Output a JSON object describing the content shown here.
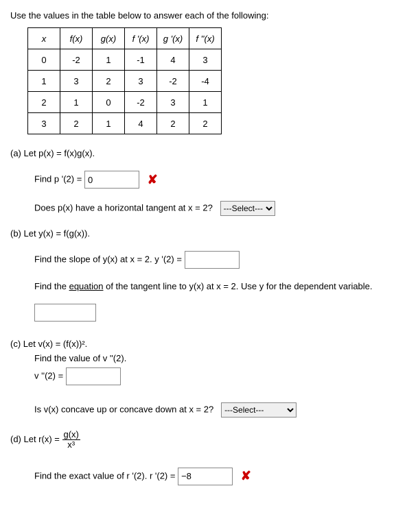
{
  "intro": "Use the values in the table below to answer each of the following:",
  "table": {
    "headers": [
      "x",
      "f(x)",
      "g(x)",
      "f '(x)",
      "g '(x)",
      "f ''(x)"
    ],
    "rows": [
      [
        "0",
        "-2",
        "1",
        "-1",
        "4",
        "3"
      ],
      [
        "1",
        "3",
        "2",
        "3",
        "-2",
        "-4"
      ],
      [
        "2",
        "1",
        "0",
        "-2",
        "3",
        "1"
      ],
      [
        "3",
        "2",
        "1",
        "4",
        "2",
        "2"
      ]
    ]
  },
  "a": {
    "label": "(a) Let p(x) = f(x)g(x).",
    "find_label": "Find p '(2) = ",
    "find_value": "0",
    "tangent_q": "Does p(x) have a horizontal tangent at x = 2?",
    "select_placeholder": "---Select---"
  },
  "b": {
    "label": "(b) Let y(x) = f(g(x)).",
    "slope_label": "Find the slope of y(x) at x = 2. y '(2) = ",
    "slope_value": "",
    "eqn_label_1": "Find the ",
    "eqn_link": "equation",
    "eqn_label_2": " of the tangent line to y(x) at x = 2. Use y for the dependent variable.",
    "eqn_value": ""
  },
  "c": {
    "label": "(c) Let v(x) = (f(x))².",
    "find_label": "Find the value of v ''(2).",
    "vpp_label": "v ''(2) = ",
    "vpp_value": "",
    "concave_q": "Is v(x) concave up or concave down at x = 2?",
    "select_placeholder": "---Select---"
  },
  "d": {
    "label_prefix": "(d) Let  r(x) = ",
    "frac_num": "g(x)",
    "frac_den": "x³",
    "find_label": "Find the exact value of r '(2). r '(2) = ",
    "find_value": "−8"
  }
}
